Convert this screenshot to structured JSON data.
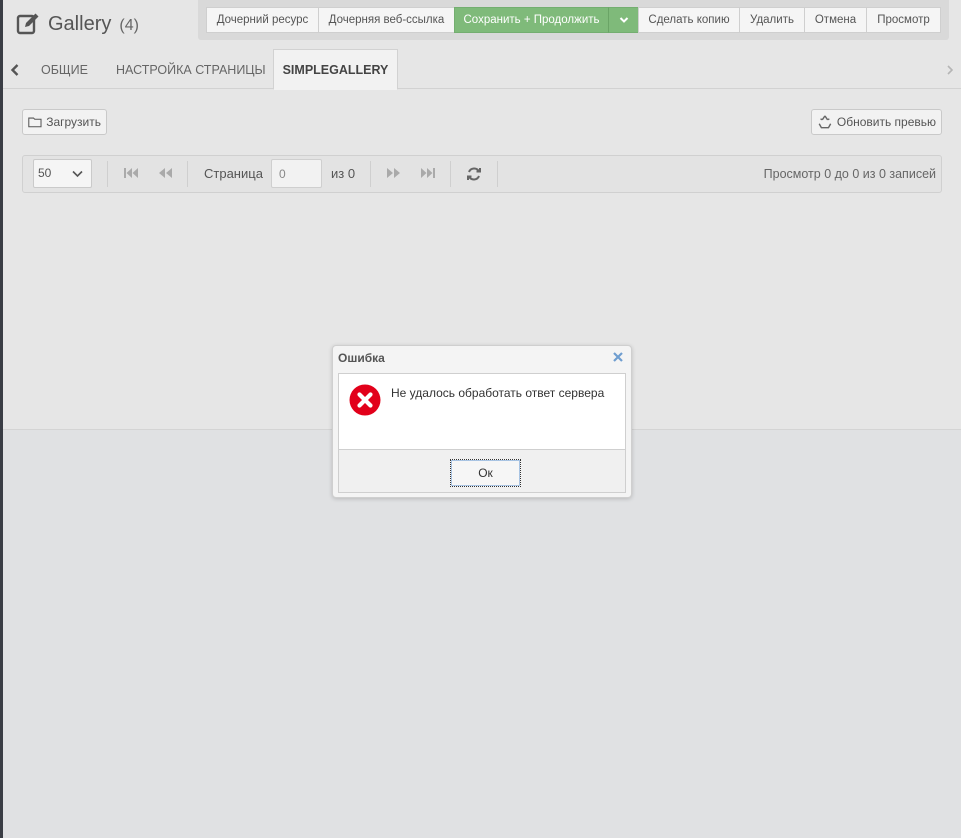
{
  "header": {
    "title": "Gallery",
    "count": "(4)",
    "icon": "edit-icon"
  },
  "actions": {
    "child_resource": "Дочерний ресурс",
    "child_weblink": "Дочерняя веб-ссылка",
    "save_continue": "Сохранить + Продолжить",
    "duplicate": "Сделать копию",
    "delete": "Удалить",
    "cancel": "Отмена",
    "view": "Просмотр"
  },
  "tabs": {
    "general": "ОБЩИЕ",
    "page_settings": "НАСТРОЙКА СТРАНИЦЫ",
    "simplegallery": "SIMPLEGALLERY",
    "active": "SIMPLEGALLERY"
  },
  "toolbar": {
    "upload": "Загрузить",
    "refresh_preview": "Обновить превью"
  },
  "pager": {
    "page_size": "50",
    "page_label": "Страница",
    "page_value": "0",
    "of_label": "из 0",
    "records": "Просмотр 0 до 0 из 0 записей"
  },
  "dialog": {
    "title": "Ошибка",
    "message": "Не удалось обработать ответ сервера",
    "ok": "Ок",
    "icon": "error-icon"
  },
  "colors": {
    "primary_button": "#7fba7a",
    "error": "#e2001a",
    "background": "#e0e1e3"
  }
}
